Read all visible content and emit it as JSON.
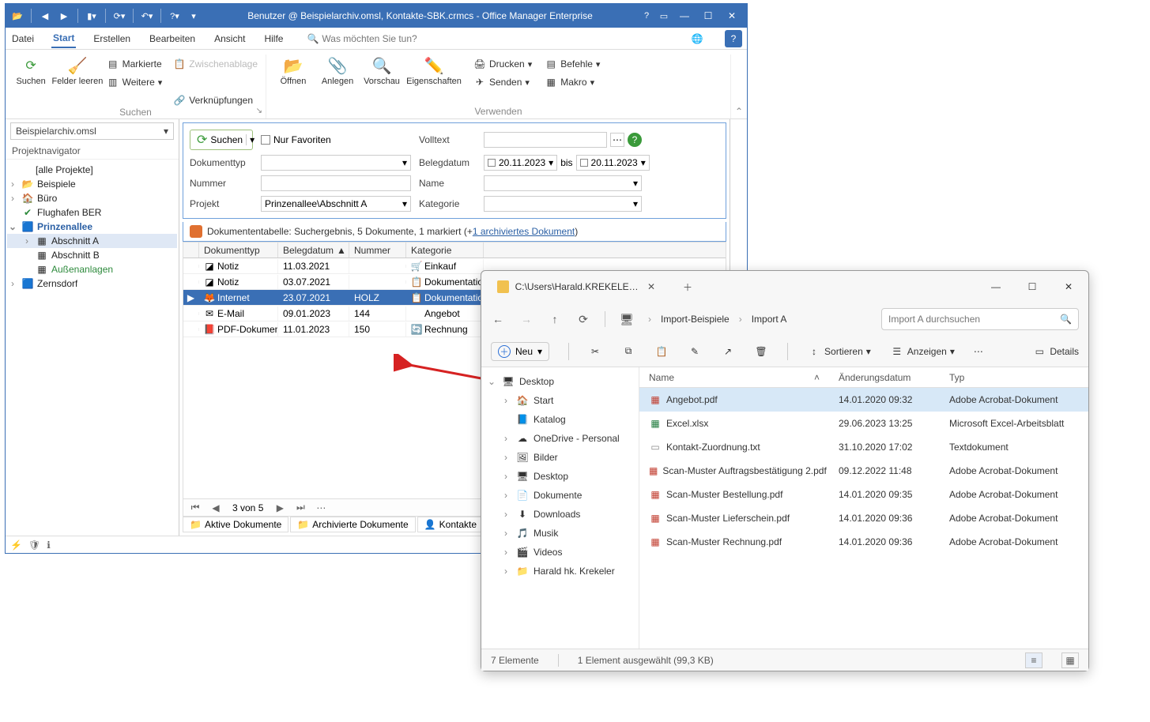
{
  "om": {
    "title": "Benutzer @ Beispielarchiv.omsl, Kontakte-SBK.crmcs - Office Manager Enterprise",
    "ribbon_tabs": {
      "datei": "Datei",
      "start": "Start",
      "erstellen": "Erstellen",
      "bearbeiten": "Bearbeiten",
      "ansicht": "Ansicht",
      "hilfe": "Hilfe",
      "search_hint": "Was möchten Sie tun?"
    },
    "groups": {
      "suchen_caption": "Suchen",
      "verwenden_caption": "Verwenden",
      "suchen": "Suchen",
      "felder_leeren": "Felder leeren",
      "markierte": "Markierte",
      "zwischenablage": "Zwischenablage",
      "weitere": "Weitere",
      "verknuepfungen": "Verknüpfungen",
      "oeffnen": "Öffnen",
      "anlegen": "Anlegen",
      "vorschau": "Vorschau",
      "eigenschaften": "Eigenschaften",
      "drucken": "Drucken",
      "befehle": "Befehle",
      "senden": "Senden",
      "makro": "Makro"
    },
    "sidebar": {
      "archive": "Beispielarchiv.omsl",
      "nav_title": "Projektnavigator",
      "items": [
        {
          "label": "[alle Projekte]"
        },
        {
          "label": "Beispiele"
        },
        {
          "label": "Büro"
        },
        {
          "label": "Flughafen BER"
        },
        {
          "label": "Prinzenallee"
        },
        {
          "label": "Abschnitt A"
        },
        {
          "label": "Abschnitt B"
        },
        {
          "label": "Außenanlagen"
        },
        {
          "label": "Zernsdorf"
        }
      ]
    },
    "search": {
      "suchen": "Suchen",
      "nur_fav": "Nur Favoriten",
      "dokumenttyp": "Dokumenttyp",
      "volltext": "Volltext",
      "belegdatum": "Belegdatum",
      "bis": "bis",
      "nummer": "Nummer",
      "name": "Name",
      "projekt": "Projekt",
      "projekt_val": "Prinzenallee\\Abschnitt A",
      "kategorie": "Kategorie",
      "date": "20.11.2023"
    },
    "result": {
      "prefix": "Dokumententabelle: Suchergebnis, 5 Dokumente, 1 markiert (+",
      "link": "1 archiviertes Dokument",
      "suffix": ")"
    },
    "table": {
      "headers": {
        "typ": "Dokumenttyp",
        "beleg": "Belegdatum",
        "nummer": "Nummer",
        "kategorie": "Kategorie"
      },
      "rows": [
        {
          "typ": "Notiz",
          "beleg": "11.03.2021",
          "nummer": "",
          "kat": "Einkauf",
          "kico": "🛒"
        },
        {
          "typ": "Notiz",
          "beleg": "03.07.2021",
          "nummer": "",
          "kat": "Dokumentation",
          "kico": "📋"
        },
        {
          "typ": "Internet",
          "beleg": "23.07.2021",
          "nummer": "HOLZ",
          "kat": "Dokumentation",
          "kico": "📋"
        },
        {
          "typ": "E-Mail",
          "beleg": "09.01.2023",
          "nummer": "144",
          "kat": "Angebot",
          "kico": ""
        },
        {
          "typ": "PDF-Dokument",
          "beleg": "11.01.2023",
          "nummer": "150",
          "kat": "Rechnung",
          "kico": "🔄"
        }
      ]
    },
    "nav": "3 von 5",
    "bottom_tabs": {
      "aktiv": "Aktive Dokumente",
      "archiv": "Archivierte Dokumente",
      "kontakte": "Kontakte"
    },
    "vorschau": "Vorschau"
  },
  "explorer": {
    "tab_title": "C:\\Users\\Harald.KREKELER\\De:",
    "crumbs": {
      "a": "Import-Beispiele",
      "b": "Import A"
    },
    "search_placeholder": "Import A durchsuchen",
    "toolbar": {
      "neu": "Neu",
      "sort": "Sortieren",
      "view": "Anzeigen",
      "details": "Details"
    },
    "tree": [
      {
        "label": "Desktop",
        "ico": "🖥",
        "ind": 0,
        "exp": "⌄"
      },
      {
        "label": "Start",
        "ico": "🏠",
        "ind": 1,
        "exp": "›"
      },
      {
        "label": "Katalog",
        "ico": "📘",
        "ind": 1,
        "exp": ""
      },
      {
        "label": "OneDrive - Personal",
        "ico": "☁",
        "ind": 1,
        "exp": "›"
      },
      {
        "label": "Bilder",
        "ico": "🖼",
        "ind": 1,
        "exp": "›"
      },
      {
        "label": "Desktop",
        "ico": "🖥",
        "ind": 1,
        "exp": "›"
      },
      {
        "label": "Dokumente",
        "ico": "📄",
        "ind": 1,
        "exp": "›"
      },
      {
        "label": "Downloads",
        "ico": "⬇",
        "ind": 1,
        "exp": "›"
      },
      {
        "label": "Musik",
        "ico": "🎵",
        "ind": 1,
        "exp": "›"
      },
      {
        "label": "Videos",
        "ico": "🎬",
        "ind": 1,
        "exp": "›"
      },
      {
        "label": "Harald hk. Krekeler",
        "ico": "📁",
        "ind": 1,
        "exp": "›"
      }
    ],
    "headers": {
      "name": "Name",
      "date": "Änderungsdatum",
      "type": "Typ"
    },
    "files": [
      {
        "name": "Angebot.pdf",
        "date": "14.01.2020 09:32",
        "type": "Adobe Acrobat-Dokument",
        "ico": "pdf",
        "sel": true
      },
      {
        "name": "Excel.xlsx",
        "date": "29.06.2023 13:25",
        "type": "Microsoft Excel-Arbeitsblatt",
        "ico": "xls",
        "sel": false
      },
      {
        "name": "Kontakt-Zuordnung.txt",
        "date": "31.10.2020 17:02",
        "type": "Textdokument",
        "ico": "txt",
        "sel": false
      },
      {
        "name": "Scan-Muster Auftragsbestätigung 2.pdf",
        "date": "09.12.2022 11:48",
        "type": "Adobe Acrobat-Dokument",
        "ico": "pdf",
        "sel": false
      },
      {
        "name": "Scan-Muster Bestellung.pdf",
        "date": "14.01.2020 09:35",
        "type": "Adobe Acrobat-Dokument",
        "ico": "pdf",
        "sel": false
      },
      {
        "name": "Scan-Muster Lieferschein.pdf",
        "date": "14.01.2020 09:36",
        "type": "Adobe Acrobat-Dokument",
        "ico": "pdf",
        "sel": false
      },
      {
        "name": "Scan-Muster Rechnung.pdf",
        "date": "14.01.2020 09:36",
        "type": "Adobe Acrobat-Dokument",
        "ico": "pdf",
        "sel": false
      }
    ],
    "status": {
      "count": "7 Elemente",
      "sel": "1 Element ausgewählt (99,3 KB)"
    }
  }
}
